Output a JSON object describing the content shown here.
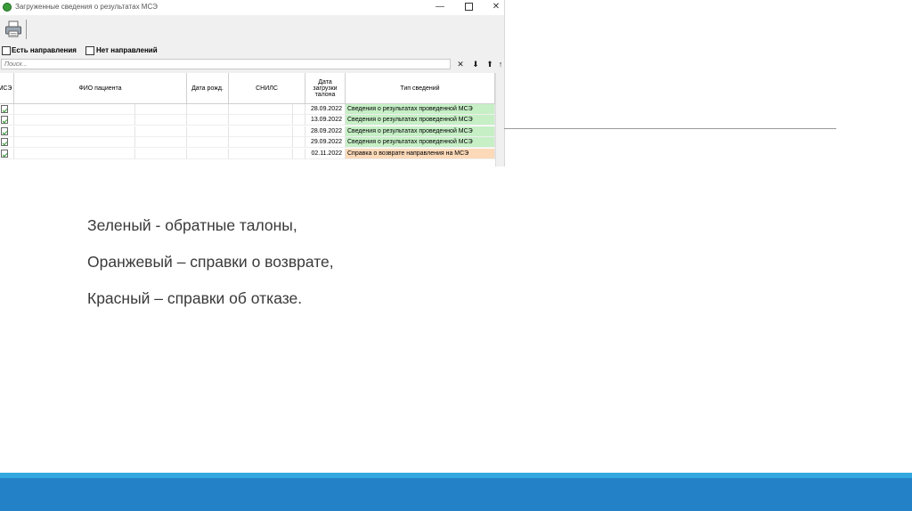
{
  "window": {
    "title": "Загруженные сведения о результатах МСЭ",
    "min_glyph": "—",
    "close_glyph": "✕"
  },
  "filters": {
    "has_referral": "Есть направления",
    "no_referral": "Нет направлений"
  },
  "search": {
    "placeholder": "Поиск...",
    "clear_glyph": "✕",
    "down_glyph": "⬇",
    "up_glyph": "⬆",
    "extra_glyph": "↑"
  },
  "table": {
    "columns": {
      "mse": "МСЭ",
      "fio": "ФИО пациента",
      "birth": "Дата рожд.",
      "snils": "СНИЛС",
      "upload_date": "Дата загрузки талона",
      "type": "Тип сведений"
    },
    "rows": [
      {
        "date": "28.09.2022",
        "type": "Сведения о результатах проведенной МСЭ",
        "color": "#c6efc6"
      },
      {
        "date": "13.09.2022",
        "type": "Сведения о результатах проведенной МСЭ",
        "color": "#c6efc6"
      },
      {
        "date": "28.09.2022",
        "type": "Сведения о результатах проведенной МСЭ",
        "color": "#c6efc6"
      },
      {
        "date": "29.09.2022",
        "type": "Сведения о результатах проведенной МСЭ",
        "color": "#c6efc6"
      },
      {
        "date": "02.11.2022",
        "type": "Справка о возврате направления на МСЭ",
        "color": "#fcd9b8"
      }
    ]
  },
  "legend": {
    "green": "Зеленый  - обратные талоны,",
    "orange": "Оранжевый – справки о возврате,",
    "red": "Красный – справки об отказе."
  },
  "colors": {
    "green_row": "#c6efc6",
    "orange_row": "#fcd9b8",
    "accent_bar": "#2382c7",
    "accent_bar_light": "#31a9e0"
  }
}
